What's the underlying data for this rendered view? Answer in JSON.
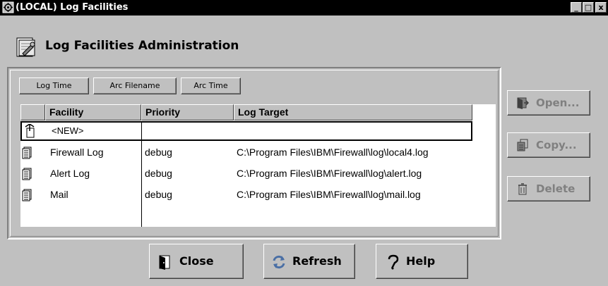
{
  "window": {
    "title": "(LOCAL) Log Facilities",
    "controls": {
      "minimize": "_",
      "maximize": "□",
      "close": "x"
    }
  },
  "header": {
    "title": "Log Facilities Administration",
    "icon": "admin-gear-icon"
  },
  "toolbar": {
    "log_time": "Log Time",
    "arc_filename": "Arc Filename",
    "arc_time": "Arc Time"
  },
  "table": {
    "columns": [
      "Facility",
      "Priority",
      "Log Target"
    ],
    "new_row_label": "<NEW>",
    "rows": [
      {
        "facility": "Firewall Log",
        "priority": "debug",
        "target": "C:\\Program Files\\IBM\\Firewall\\log\\local4.log"
      },
      {
        "facility": "Alert Log",
        "priority": "debug",
        "target": "C:\\Program Files\\IBM\\Firewall\\log\\alert.log"
      },
      {
        "facility": "Mail",
        "priority": "debug",
        "target": "C:\\Program Files\\IBM\\Firewall\\log\\mail.log"
      }
    ]
  },
  "side_buttons": {
    "open": "Open...",
    "copy": "Copy...",
    "delete": "Delete"
  },
  "bottom_buttons": {
    "close": "Close",
    "refresh": "Refresh",
    "help": "Help"
  },
  "colors": {
    "window_bg": "#c0c0c0",
    "titlebar_bg": "#000000",
    "disabled_text": "#808080",
    "refresh_icon": "#4a6fa5"
  }
}
